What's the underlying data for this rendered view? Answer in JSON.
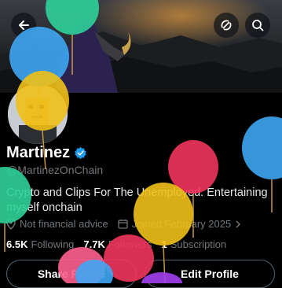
{
  "profile": {
    "name": "Martinez",
    "handle": "@MartinezOnChain",
    "bio": "Crypto and Clips For The Unemployed. Entertaining myself onchain",
    "meta_advice": "Not financial advice",
    "meta_joined": "Joined February 2025",
    "following_count": "6.5K",
    "following_label": "Following",
    "followers_count": "7.7K",
    "followers_label": "Followers",
    "subscription_count": "1",
    "subscription_label": "Subscription"
  },
  "buttons": {
    "share": "Share Profile",
    "edit": "Edit Profile"
  },
  "icons": {
    "back": "arrow-left-icon",
    "grok": "grok-icon",
    "search": "search-icon",
    "verified": "verified-badge-icon",
    "location": "location-pin-icon",
    "calendar": "calendar-icon",
    "chevron": "chevron-right-icon"
  },
  "colors": {
    "verified": "#1d9bf0",
    "muted": "#71767b"
  }
}
